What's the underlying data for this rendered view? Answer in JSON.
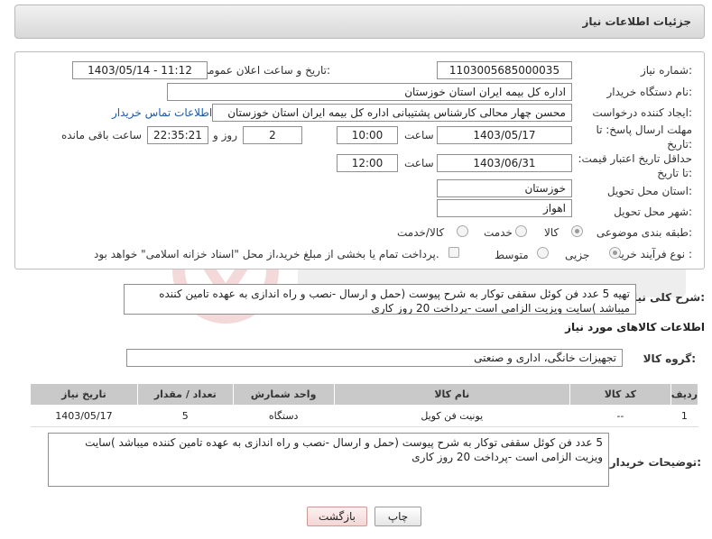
{
  "header": {
    "title": "جزئیات اطلاعات نیاز"
  },
  "form": {
    "need_number_label": "شماره نیاز:",
    "need_number": "1103005685000035",
    "announce_label": "تاریخ و ساعت اعلان عمومی:",
    "announce_value": "1403/05/14 - 11:12",
    "buyer_org_label": "نام دستگاه خریدار:",
    "buyer_org": "اداره کل بیمه ایران استان خوزستان",
    "creator_label": "ایجاد کننده درخواست:",
    "creator": "محسن چهار محالی کارشناس پشتیبانی اداره کل بیمه ایران استان خوزستان",
    "contact_link": "اطلاعات تماس خریدار",
    "deadline_label": "مهلت ارسال پاسخ: تا تاریخ:",
    "deadline_date": "1403/05/17",
    "time_label": "ساعت",
    "deadline_time": "10:00",
    "days_value": "2",
    "days_label": "روز و",
    "remaining_time": "22:35:21",
    "remaining_label": "ساعت باقی مانده",
    "validity_label": "حداقل تاریخ اعتبار قیمت: تا تاریخ:",
    "validity_date": "1403/06/31",
    "validity_time": "12:00",
    "province_label": "استان محل تحویل:",
    "province": "خوزستان",
    "city_label": "شهر محل تحویل:",
    "city": "اهواز",
    "category_label": "طبقه بندی موضوعی:",
    "category_options": [
      "کالا",
      "خدمت",
      "کالا/خدمت"
    ],
    "process_label": "نوع فرآیند خرید :",
    "process_options": [
      "جزیی",
      "متوسط"
    ],
    "payment_note": "پرداخت تمام یا بخشی از مبلغ خرید،از محل \"اسناد خزانه اسلامی\" خواهد بود."
  },
  "summary": {
    "label": "شرح کلی نیاز:",
    "text": "تهیه 5 عدد فن کوئل سقفی توکار  به شرح پیوست (حمل و ارسال -نصب و راه اندازی به عهده تامین کننده میباشد )سایت ویزیت الزامی است -پرداخت 20 روز کاری"
  },
  "goods": {
    "section_title": "اطلاعات کالاهای مورد نیاز",
    "group_label": "گروه کالا:",
    "group_value": "تجهیزات خانگی، اداری و صنعتی",
    "columns": [
      "ردیف",
      "کد کالا",
      "نام کالا",
      "واحد شمارش",
      "تعداد / مقدار",
      "تاریخ نیاز"
    ],
    "rows": [
      [
        "1",
        "--",
        "یونیت فن کویل",
        "دستگاه",
        "5",
        "1403/05/17"
      ]
    ]
  },
  "buyer_notes": {
    "label": "توضیحات خریدار:",
    "text": "5 عدد فن کوئل سقفی توکار  به شرح پیوست (حمل و ارسال -نصب و راه اندازی به عهده تامین کننده میباشد )سایت ویزیت الزامی است -پرداخت 20 روز کاری"
  },
  "buttons": {
    "print": "چاپ",
    "back": "بازگشت"
  },
  "colors": {
    "link": "#1a5aa8",
    "table_header": "#c9c9c9",
    "back_button": "#f3d6d6"
  }
}
